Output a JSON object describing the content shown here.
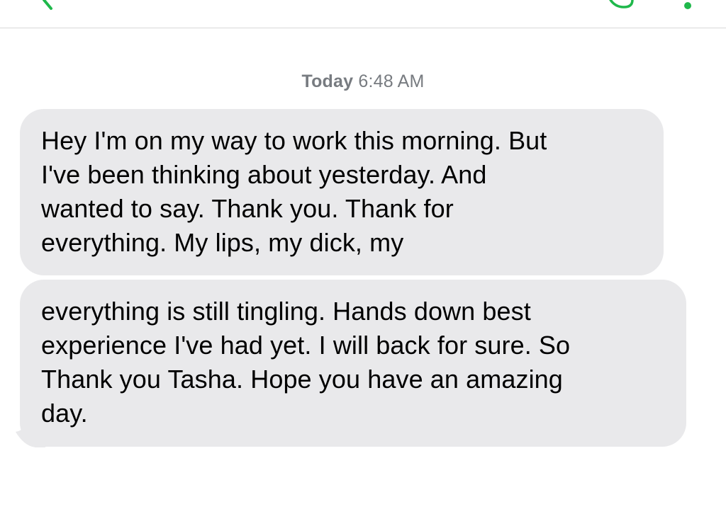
{
  "colors": {
    "accent": "#1fb84b",
    "bubble_received": "#e9e9eb",
    "timestamp_text": "#777b80",
    "divider": "#d9d9d9"
  },
  "nav": {
    "back_icon": "chevron-left-icon",
    "video_icon": "video-call-icon",
    "more_icon": "more-dots-icon"
  },
  "conversation": {
    "timestamp": {
      "day": "Today",
      "time": "6:48 AM"
    },
    "messages": [
      {
        "direction": "received",
        "text": "Hey I'm on my way to work this morning. But\nI've been thinking about yesterday. And\nwanted to say. Thank you. Thank for\neverything. My lips, my dick, my"
      },
      {
        "direction": "received",
        "text": "everything is still tingling. Hands down best\nexperience I've had yet. I will back for sure. So\nThank you Tasha. Hope you have an amazing\nday."
      }
    ]
  }
}
